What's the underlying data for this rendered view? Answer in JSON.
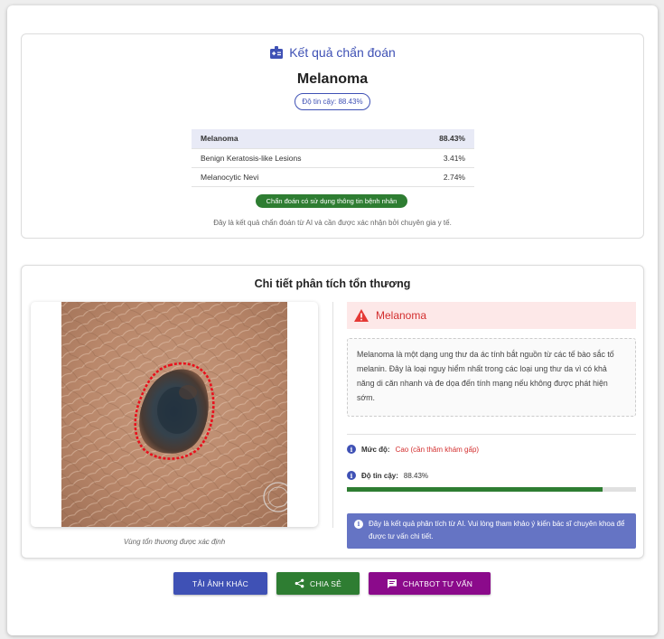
{
  "result": {
    "title": "Kết quả chẩn đoán",
    "diagnosis": "Melanoma",
    "confidence_label": "Độ tin cậy: 88.43%",
    "predictions": [
      {
        "name": "Melanoma",
        "value": "88.43%"
      },
      {
        "name": "Benign Keratosis-like Lesions",
        "value": "3.41%"
      },
      {
        "name": "Melanocytic Nevi",
        "value": "2.74%"
      }
    ],
    "patient_info_chip": "Chẩn đoán có sử dụng thông tin bệnh nhân",
    "disclaimer": "Đây là kết quả chẩn đoán từ AI và cần được xác nhận bởi chuyên gia y tế."
  },
  "detail": {
    "title": "Chi tiết phân tích tổn thương",
    "image_caption": "Vùng tổn thương được xác định",
    "alert_label": "Melanoma",
    "description": "Melanoma là một dạng ung thư da ác tính bắt nguồn từ các tế bào sắc tố melanin. Đây là loại nguy hiểm nhất trong các loại ung thư da vì có khả năng di căn nhanh và đe dọa đến tính mạng nếu không được phát hiện sớm.",
    "severity_label": "Mức độ:",
    "severity_value": "Cao (cần thăm khám gấp)",
    "confidence_label": "Độ tin cậy:",
    "confidence_value": "88.43%",
    "confidence_fraction": 0.8843,
    "note": "Đây là kết quả phân tích từ AI. Vui lòng tham khảo ý kiến bác sĩ chuyên khoa để được tư vấn chi tiết."
  },
  "buttons": {
    "retake": "TẢI ẢNH KHÁC",
    "share": "CHIA SẺ",
    "chatbot": "CHATBOT TƯ VẤN"
  },
  "colors": {
    "primary": "#3f51b5",
    "success": "#2e7d32",
    "danger": "#d32f2f",
    "chat": "#8b0a8b"
  }
}
